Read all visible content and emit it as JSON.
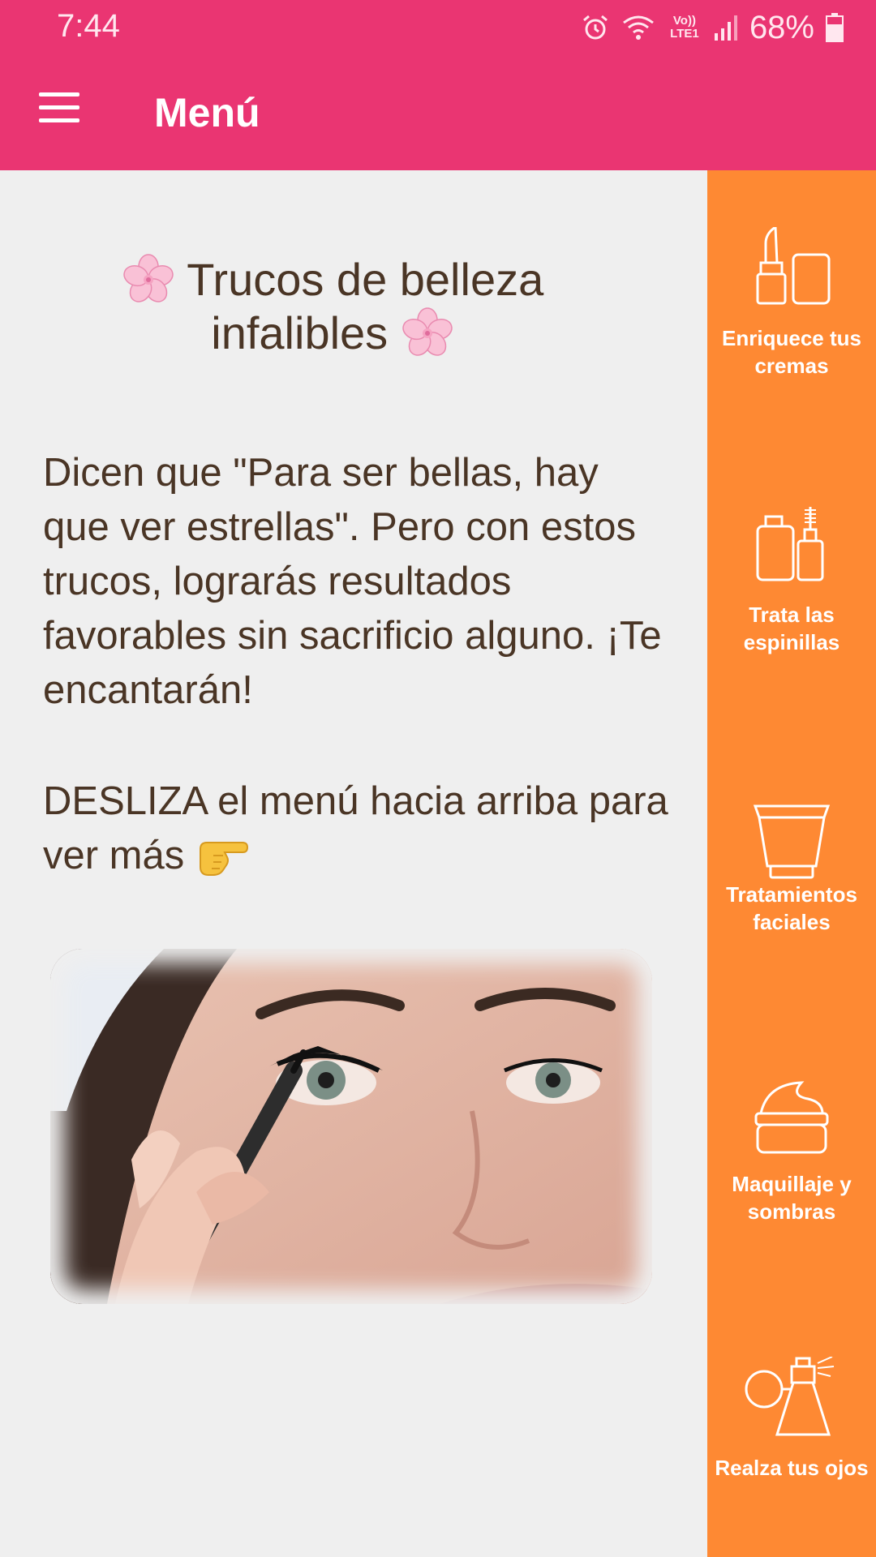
{
  "status_bar": {
    "time": "7:44",
    "network": "Vo)) LTE1",
    "battery": "68%"
  },
  "app_bar": {
    "title": "Menú",
    "color": "#ea3572"
  },
  "content": {
    "title_line1": "Trucos de belleza",
    "title_line2": "infalibles",
    "intro": "Dicen que \"Para ser bellas, hay que ver estrellas\". Pero con estos trucos, lograrás resultados favorables sin sacrificio alguno. ¡Te encantarán!",
    "hint": "DESLIZA el menú hacia arriba para ver más"
  },
  "side_menu": {
    "color": "#fe8933",
    "items": [
      {
        "label": "Enriquece tus cremas",
        "icon": "lipstick-cream-icon"
      },
      {
        "label": "Trata las espinillas",
        "icon": "bottles-brush-icon"
      },
      {
        "label": "Tratamientos faciales",
        "icon": "cream-tube-icon"
      },
      {
        "label": "Maquillaje y sombras",
        "icon": "cream-jar-icon"
      },
      {
        "label": "Realza tus ojos",
        "icon": "perfume-bottle-icon"
      }
    ]
  }
}
